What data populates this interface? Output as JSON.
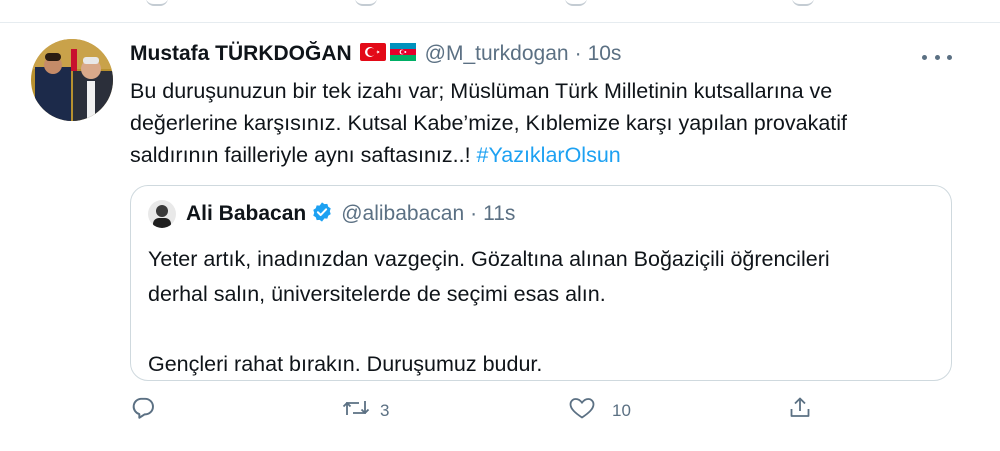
{
  "tweet": {
    "author": {
      "display_name": "Mustafa TÜRKDOĞAN",
      "flags": [
        "turkey-flag",
        "azerbaijan-flag"
      ],
      "handle": "@M_turkdogan",
      "separator": "·",
      "time": "10s"
    },
    "text": {
      "body": "Bu duruşunuzun bir tek izahı var; Müslüman Türk Milletinin kutsallarına ve değerlerine karşısınız. Kutsal Kabe’mize, Kıblemize karşı yapılan provakatif saldırının failleriyle aynı saftasınız..! ",
      "hashtag": "#YazıklarOlsun"
    },
    "quoted": {
      "display_name": "Ali Babacan",
      "verified_icon": "verified-badge-icon",
      "handle": "@alibabacan",
      "separator": "·",
      "time": "11s",
      "paragraph_1_line_1": "Yeter artık, inadınızdan vazgeçin. Gözaltına alınan Boğaziçili öğrencileri",
      "paragraph_1_line_2": "derhal salın, üniversitelerde de seçimi esas alın.",
      "paragraph_2": "Gençleri rahat bırakın. Duruşumuz budur."
    },
    "actions": {
      "reply_icon": "reply-icon",
      "retweet_icon": "retweet-icon",
      "retweet_count": "3",
      "like_icon": "heart-icon",
      "like_count": "10",
      "share_icon": "share-icon"
    }
  },
  "colors": {
    "link": "#1da1f2",
    "secondary_text": "#5b7083",
    "verified": "#1da1f2",
    "border": "#cfd9de"
  }
}
